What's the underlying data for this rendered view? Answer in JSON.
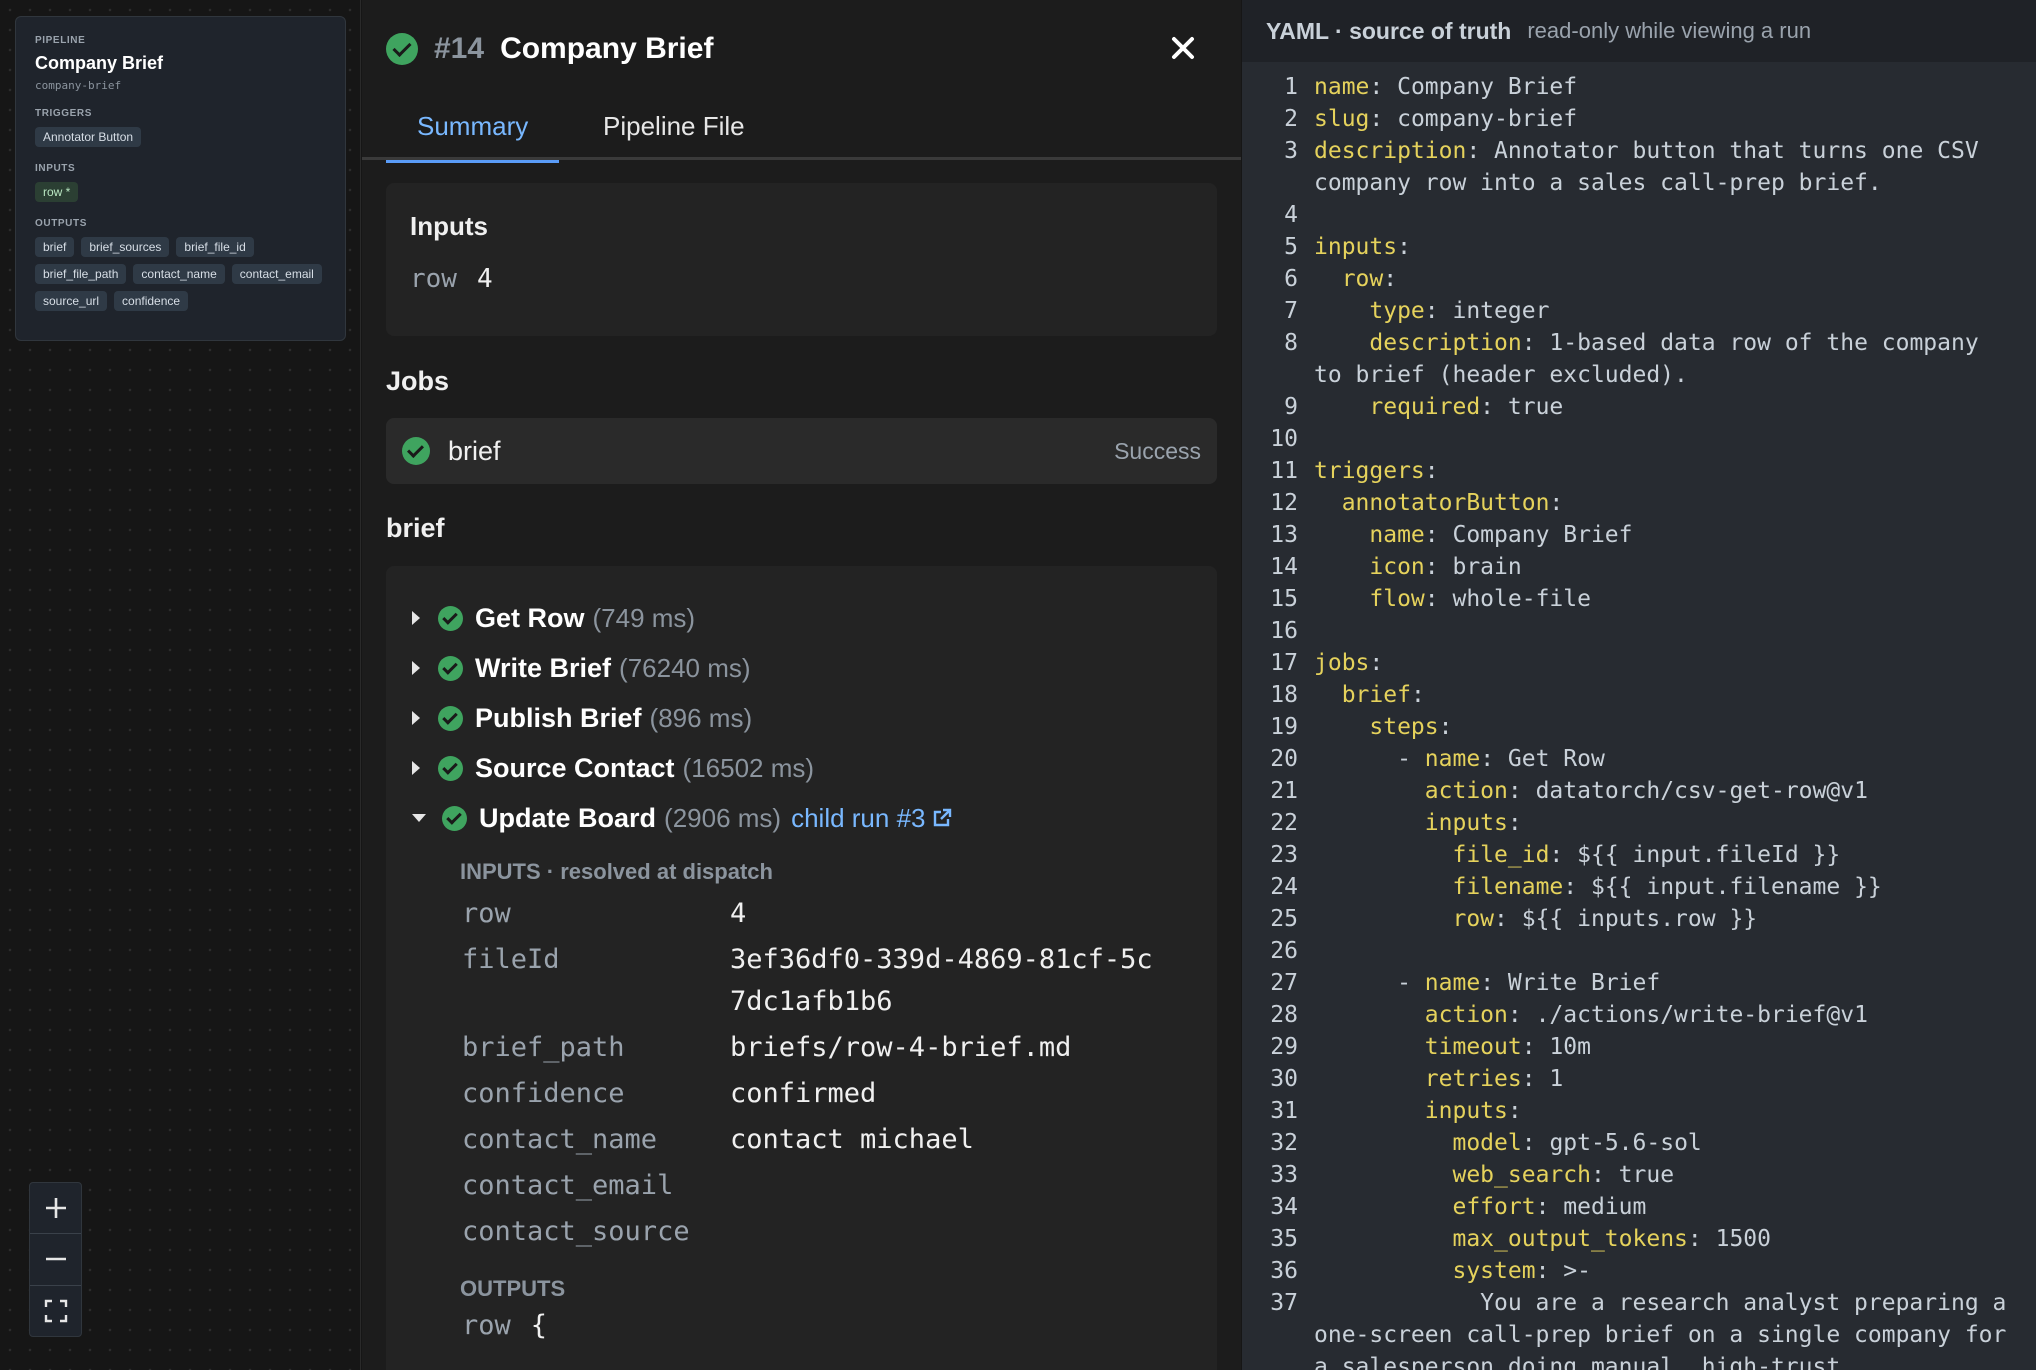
{
  "pipeline_card": {
    "kicker": "PIPELINE",
    "title": "Company Brief",
    "slug": "company-brief",
    "triggers_label": "TRIGGERS",
    "triggers": [
      "Annotator Button"
    ],
    "inputs_label": "INPUTS",
    "inputs": [
      "row *"
    ],
    "outputs_label": "OUTPUTS",
    "outputs": [
      "brief",
      "brief_sources",
      "brief_file_id",
      "brief_file_path",
      "contact_name",
      "contact_email",
      "source_url",
      "confidence"
    ]
  },
  "zoom_controls": [
    "zoom-in-icon",
    "zoom-out-icon",
    "fit-view-icon"
  ],
  "run": {
    "number": "#14",
    "title": "Company Brief",
    "status_icon": "success-check-icon",
    "tabs": [
      "Summary",
      "Pipeline File"
    ],
    "active_tab": "Summary",
    "inputs_title": "Inputs",
    "inputs": [
      {
        "key": "row",
        "value": "4"
      }
    ],
    "jobs_title": "Jobs",
    "jobs": [
      {
        "name": "brief",
        "status": "Success"
      }
    ],
    "job_section_title": "brief",
    "steps": [
      {
        "name": "Get Row",
        "time": "(749 ms)",
        "expanded": false
      },
      {
        "name": "Write Brief",
        "time": "(76240 ms)",
        "expanded": false
      },
      {
        "name": "Publish Brief",
        "time": "(896 ms)",
        "expanded": false
      },
      {
        "name": "Source Contact",
        "time": "(16502 ms)",
        "expanded": false
      },
      {
        "name": "Update Board",
        "time": "(2906 ms)",
        "expanded": true,
        "link": "child run #3"
      }
    ],
    "resolved_label": "INPUTS · resolved at dispatch",
    "resolved_inputs": [
      {
        "key": "row",
        "value": "4"
      },
      {
        "key": "fileId",
        "value": "3ef36df0-339d-4869-81cf-5c7dc1afb1b6"
      },
      {
        "key": "brief_path",
        "value": "briefs/row-4-brief.md"
      },
      {
        "key": "confidence",
        "value": "confirmed"
      },
      {
        "key": "contact_name",
        "value": "contact michael"
      },
      {
        "key": "contact_email",
        "value": ""
      },
      {
        "key": "contact_source",
        "value": ""
      }
    ],
    "outputs_label": "OUTPUTS",
    "outputs_preview": {
      "key": "row",
      "value": "{"
    }
  },
  "yaml": {
    "title": "YAML · source of truth",
    "subtitle": "read-only while viewing a run",
    "lines": [
      {
        "n": "1",
        "k": "name",
        "v": " Company Brief"
      },
      {
        "n": "2",
        "k": "slug",
        "v": " company-brief"
      },
      {
        "n": "3",
        "k": "description",
        "v": " Annotator button that turns one CSV company row into a sales call-prep brief."
      },
      {
        "n": "4"
      },
      {
        "n": "5",
        "k": "inputs",
        "v": ""
      },
      {
        "n": "6",
        "i": "  ",
        "k": "row",
        "v": ""
      },
      {
        "n": "7",
        "i": "    ",
        "k": "type",
        "v": " integer"
      },
      {
        "n": "8",
        "i": "    ",
        "k": "description",
        "v": " 1-based data row of the company to brief (header excluded)."
      },
      {
        "n": "9",
        "i": "    ",
        "k": "required",
        "v": " true"
      },
      {
        "n": "10"
      },
      {
        "n": "11",
        "k": "triggers",
        "v": ""
      },
      {
        "n": "12",
        "i": "  ",
        "k": "annotatorButton",
        "v": ""
      },
      {
        "n": "13",
        "i": "    ",
        "k": "name",
        "v": " Company Brief"
      },
      {
        "n": "14",
        "i": "    ",
        "k": "icon",
        "v": " brain"
      },
      {
        "n": "15",
        "i": "    ",
        "k": "flow",
        "v": " whole-file"
      },
      {
        "n": "16"
      },
      {
        "n": "17",
        "k": "jobs",
        "v": ""
      },
      {
        "n": "18",
        "i": "  ",
        "k": "brief",
        "v": ""
      },
      {
        "n": "19",
        "i": "    ",
        "k": "steps",
        "v": ""
      },
      {
        "n": "20",
        "i": "      - ",
        "k": "name",
        "v": " Get Row"
      },
      {
        "n": "21",
        "i": "        ",
        "k": "action",
        "v": " datatorch/csv-get-row@v1"
      },
      {
        "n": "22",
        "i": "        ",
        "k": "inputs",
        "v": ""
      },
      {
        "n": "23",
        "i": "          ",
        "k": "file_id",
        "v": " ${{ input.fileId }}"
      },
      {
        "n": "24",
        "i": "          ",
        "k": "filename",
        "v": " ${{ input.filename }}"
      },
      {
        "n": "25",
        "i": "          ",
        "k": "row",
        "v": " ${{ inputs.row }}"
      },
      {
        "n": "26"
      },
      {
        "n": "27",
        "i": "      - ",
        "k": "name",
        "v": " Write Brief"
      },
      {
        "n": "28",
        "i": "        ",
        "k": "action",
        "v": " ./actions/write-brief@v1"
      },
      {
        "n": "29",
        "i": "        ",
        "k": "timeout",
        "v": " 10m"
      },
      {
        "n": "30",
        "i": "        ",
        "k": "retries",
        "v": " 1"
      },
      {
        "n": "31",
        "i": "        ",
        "k": "inputs",
        "v": ""
      },
      {
        "n": "32",
        "i": "          ",
        "k": "model",
        "v": " gpt-5.6-sol"
      },
      {
        "n": "33",
        "i": "          ",
        "k": "web_search",
        "v": " true"
      },
      {
        "n": "34",
        "i": "          ",
        "k": "effort",
        "v": " medium"
      },
      {
        "n": "35",
        "i": "          ",
        "k": "max_output_tokens",
        "v": " 1500"
      },
      {
        "n": "36",
        "i": "          ",
        "k": "system",
        "v": " >-"
      },
      {
        "n": "37",
        "i": "            ",
        "v": "You are a research analyst preparing a one-screen call-prep brief on a single company for a salesperson doing manual, high-trust"
      }
    ]
  },
  "colors": {
    "success": "#3fa45f",
    "link": "#79b8ff",
    "yaml_key": "#e5d25c"
  }
}
